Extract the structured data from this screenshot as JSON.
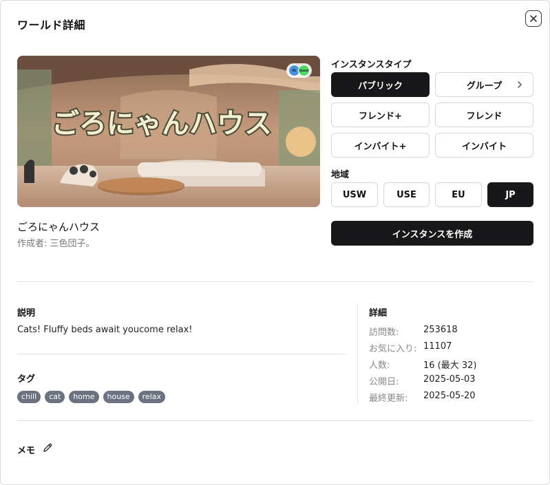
{
  "dialog": {
    "title": "ワールド詳細"
  },
  "world": {
    "thumbnail_text": "ごろにゃんハウス",
    "platform_badges": [
      "PC",
      "Quest"
    ],
    "name": "ごろにゃんハウス",
    "author": "作成者: 三色団子。"
  },
  "instance": {
    "type_label": "インスタンスタイプ",
    "types": [
      {
        "label": "パブリック",
        "active": true
      },
      {
        "label": "グループ",
        "active": false,
        "has_chevron": true
      },
      {
        "label": "フレンド+",
        "active": false
      },
      {
        "label": "フレンド",
        "active": false
      },
      {
        "label": "インバイト+",
        "active": false
      },
      {
        "label": "インバイト",
        "active": false
      }
    ],
    "region_label": "地域",
    "regions": [
      {
        "label": "USW",
        "active": false
      },
      {
        "label": "USE",
        "active": false
      },
      {
        "label": "EU",
        "active": false
      },
      {
        "label": "JP",
        "active": true
      }
    ],
    "create_label": "インスタンスを作成"
  },
  "description": {
    "heading": "説明",
    "text": "Cats! Fluffy beds await youcome relax!"
  },
  "tags": {
    "heading": "タグ",
    "items": [
      "chill",
      "cat",
      "home",
      "house",
      "relax"
    ]
  },
  "details": {
    "heading": "詳細",
    "rows": [
      {
        "key": "訪問数:",
        "value": "253618"
      },
      {
        "key": "お気に入り:",
        "value": "11107"
      },
      {
        "key": "人数:",
        "value": "16 (最大 32)"
      },
      {
        "key": "公開日:",
        "value": "2025-05-03"
      },
      {
        "key": "最終更新:",
        "value": "2025-05-20"
      }
    ]
  },
  "memo": {
    "label": "メモ"
  },
  "icons": {
    "close": "close-icon",
    "edit": "pencil-icon",
    "chevron": "chevron-right-icon"
  },
  "colors": {
    "primary": "#18181b",
    "tag_bg": "#6b7280",
    "muted": "#888888"
  }
}
